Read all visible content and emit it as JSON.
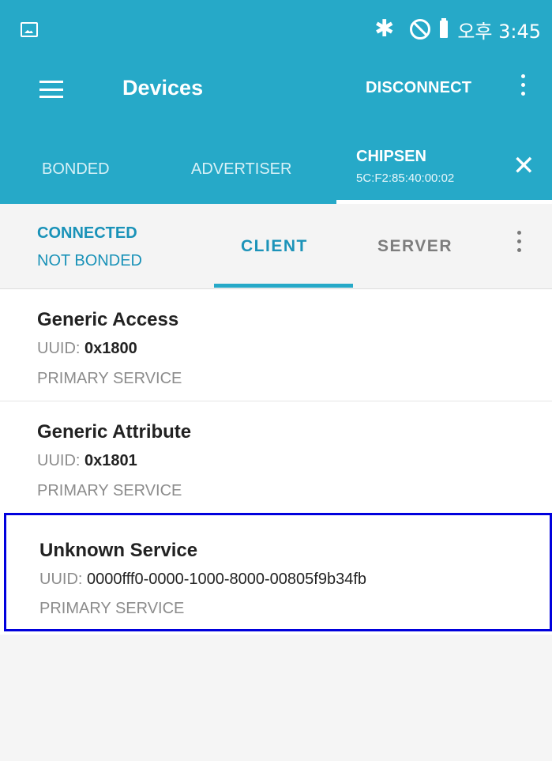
{
  "status_bar": {
    "bluetooth_icon": "bluetooth-icon",
    "block_icon": "do-not-disturb-icon",
    "battery_icon": "battery-icon",
    "time": "오후 3:45"
  },
  "app_bar": {
    "title": "Devices",
    "disconnect_label": "DISCONNECT",
    "menu_icon": "hamburger-icon",
    "overflow_icon": "more-vert-icon"
  },
  "tabs": {
    "bonded": "BONDED",
    "advertiser": "ADVERTISER",
    "device_name": "CHIPSEN",
    "device_address": "5C:F2:85:40:00:02",
    "close_icon": "close-icon"
  },
  "connection": {
    "state": "CONNECTED",
    "bond_state": "NOT BONDED",
    "client_tab": "CLIENT",
    "server_tab": "SERVER",
    "overflow_icon": "more-vert-icon"
  },
  "services": [
    {
      "name": "Generic Access",
      "uuid_label": "UUID: ",
      "uuid": "0x1800",
      "type": "PRIMARY SERVICE"
    },
    {
      "name": "Generic Attribute",
      "uuid_label": "UUID: ",
      "uuid": "0x1801",
      "type": "PRIMARY SERVICE"
    },
    {
      "name": "Unknown Service",
      "uuid_label": "UUID: ",
      "uuid": "0000fff0-0000-1000-8000-00805f9b34fb",
      "type": "PRIMARY SERVICE"
    }
  ],
  "colors": {
    "primary": "#26a9c8",
    "accent": "#1992b8",
    "highlight_border": "#0000dd"
  }
}
